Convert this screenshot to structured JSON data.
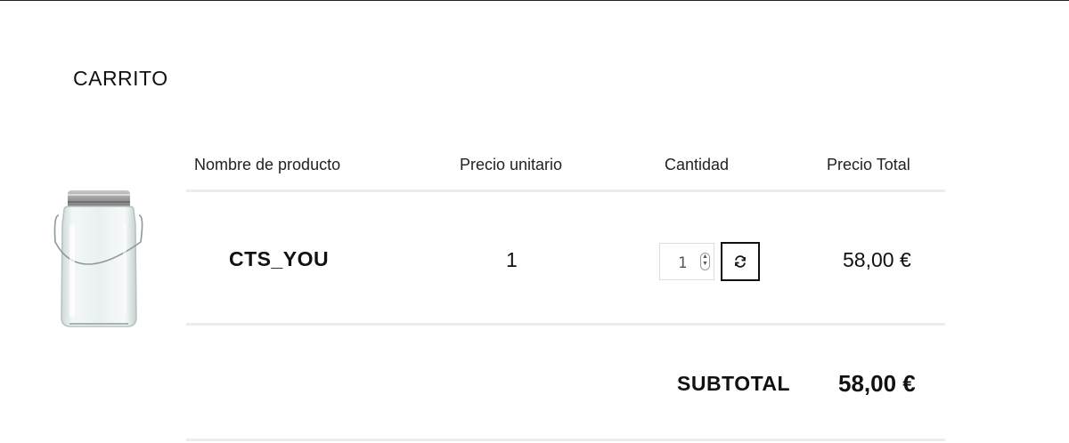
{
  "page": {
    "title": "CARRITO"
  },
  "table": {
    "headers": {
      "product_name": "Nombre de producto",
      "unit_price": "Precio unitario",
      "quantity": "Cantidad",
      "total_price": "Precio Total"
    },
    "rows": [
      {
        "name": "CTS_YOU",
        "unit_price": "1",
        "quantity": "1",
        "total": "58,00 €",
        "image_icon": "glass-jar-icon"
      }
    ]
  },
  "summary": {
    "label": "SUBTOTAL",
    "value": "58,00 €"
  },
  "icons": {
    "refresh": "refresh-icon",
    "spinner": "spinner-arrows-icon"
  }
}
